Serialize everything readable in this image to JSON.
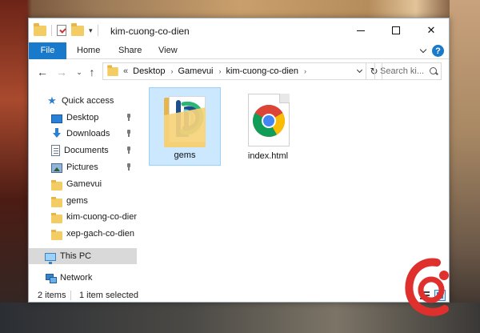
{
  "window": {
    "title": "kim-cuong-co-dien"
  },
  "ribbon": {
    "tabs": [
      "File",
      "Home",
      "Share",
      "View"
    ]
  },
  "address": {
    "lead": "«",
    "crumbs": [
      "Desktop",
      "Gamevui",
      "kim-cuong-co-dien"
    ],
    "search_placeholder": "Search ki..."
  },
  "sidebar": {
    "items": [
      {
        "label": "Quick access",
        "icon": "star-icon"
      },
      {
        "label": "Desktop",
        "icon": "desktop-icon",
        "pinned": true
      },
      {
        "label": "Downloads",
        "icon": "download-icon",
        "pinned": true
      },
      {
        "label": "Documents",
        "icon": "documents-icon",
        "pinned": true
      },
      {
        "label": "Pictures",
        "icon": "pictures-icon",
        "pinned": true
      },
      {
        "label": "Gamevui",
        "icon": "folder-icon"
      },
      {
        "label": "gems",
        "icon": "folder-icon"
      },
      {
        "label": "kim-cuong-co-dien",
        "icon": "folder-icon"
      },
      {
        "label": "xep-gach-co-dien",
        "icon": "folder-icon"
      },
      {
        "label": "This PC",
        "icon": "pc-icon"
      },
      {
        "label": "Network",
        "icon": "network-icon"
      }
    ]
  },
  "files": [
    {
      "name": "gems",
      "type": "folder",
      "selected": true
    },
    {
      "name": "index.html",
      "type": "chrome-html",
      "selected": false
    }
  ],
  "status": {
    "count": "2 items",
    "selected": "1 item selected"
  },
  "colors": {
    "accent": "#1979ca",
    "selection": "#cce8ff",
    "folder": "#f3cd63"
  }
}
